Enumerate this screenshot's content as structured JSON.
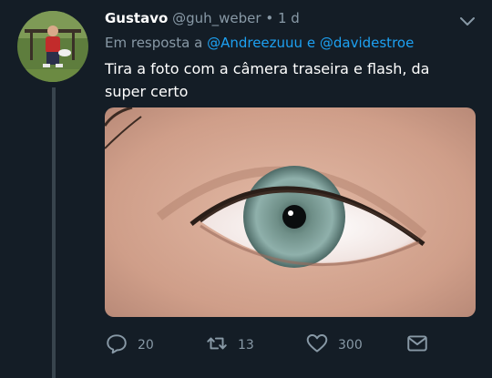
{
  "tweet": {
    "author_name": "Gustavo",
    "author_handle": "@guh_weber",
    "separator": "•",
    "time": "1 d",
    "reply_prefix": "Em resposta a",
    "reply_mention_1": "@Andreezuuu",
    "reply_joiner": "e",
    "reply_mention_2": "@davidestroe",
    "text": "Tira a foto com a câmera traseira e flash, da super certo",
    "media_alt": "eye-photo",
    "actions": {
      "reply_count": "20",
      "retweet_count": "13",
      "like_count": "300"
    }
  },
  "colors": {
    "background": "#141d26",
    "muted": "#8899a6",
    "link": "#1da1f2",
    "thread_line": "#38444d"
  },
  "icons": {
    "menu": "chevron-down-icon",
    "reply": "reply-icon",
    "retweet": "retweet-icon",
    "like": "heart-icon",
    "dm": "mail-icon"
  }
}
